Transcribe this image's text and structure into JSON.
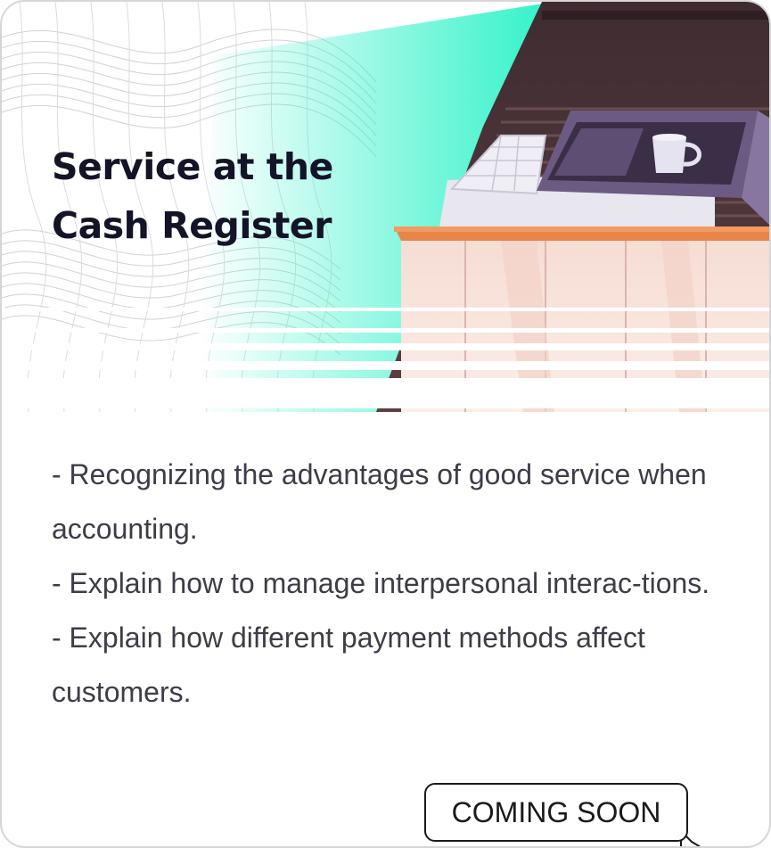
{
  "card": {
    "title_line1": "Service at the",
    "title_line2": "Cash Register",
    "description": [
      "- Recognizing the advantages of good service when accounting.",
      "- Explain how to manage interpersonal interac-tions.",
      "- Explain how different payment methods affect customers."
    ],
    "badge_label": "COMING SOON"
  },
  "colors": {
    "accent_mint": "#2ff2c8",
    "title_text": "#141428",
    "body_text": "#3d3d4a",
    "counter_orange": "#e8864a",
    "scene_dark": "#4a3438"
  },
  "icons": [
    "cash-register-illustration",
    "coffee-mug-icon"
  ]
}
